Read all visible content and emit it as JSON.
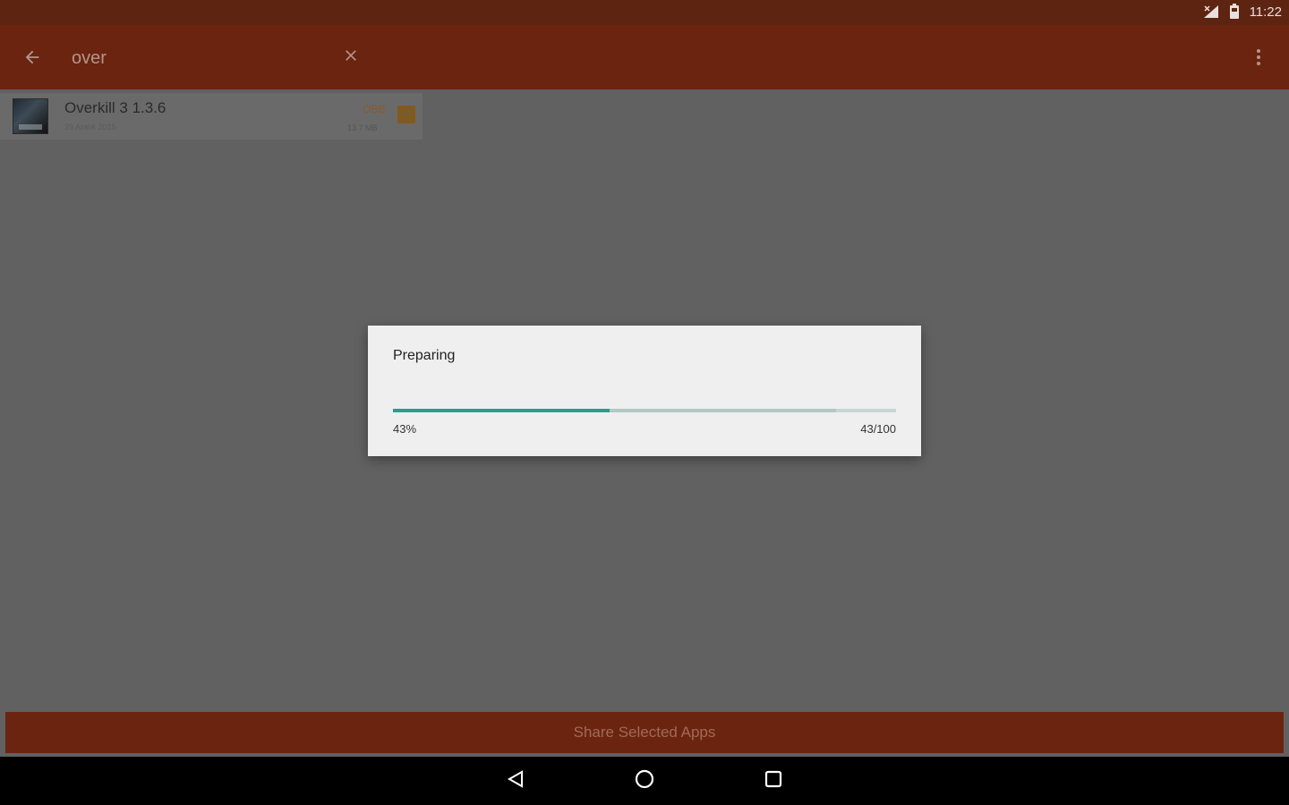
{
  "status_bar": {
    "time": "11:22",
    "icons": [
      "signal-icon",
      "battery-icon"
    ]
  },
  "toolbar": {
    "search_value": "over",
    "icons": [
      "back-arrow-icon",
      "close-icon",
      "more-vert-icon"
    ]
  },
  "app_list": {
    "items": [
      {
        "name": "Overkill 3 1.3.6",
        "date": "29 Aralık 2015",
        "badge": "OBB",
        "size": "13.7 MB",
        "checked": true
      }
    ]
  },
  "dialog": {
    "title": "Preparing",
    "progress_fraction": 0.43,
    "secondary_progress_fraction": 0.88,
    "progress_percent_label": "43%",
    "progress_count_label": "43/100",
    "progress_color": "#2c9c8e"
  },
  "actions": {
    "share_label": "Share Selected Apps"
  },
  "nav_bar": {
    "icons": [
      "back-triangle-icon",
      "home-circle-icon",
      "recents-square-icon"
    ]
  },
  "colors": {
    "toolbar": "#6b2410",
    "status_bar": "#5e2412",
    "scrim_bg": "#616161",
    "accent_checkbox": "#805a1e"
  }
}
